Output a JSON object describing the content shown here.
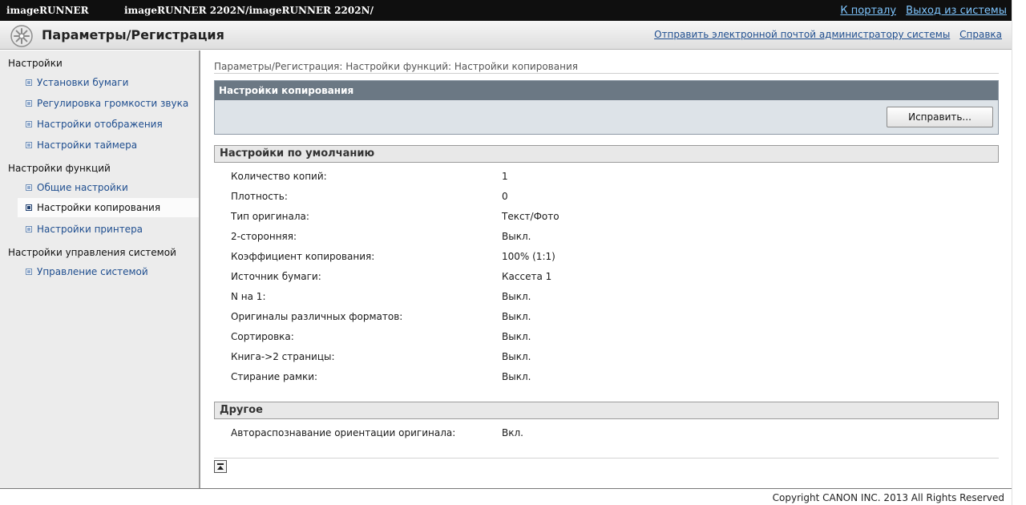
{
  "topbar": {
    "brand": "imageRUNNER",
    "model": "imageRUNNER 2202N/imageRUNNER 2202N/",
    "portal_link": "К порталу",
    "logout_link": "Выход из системы"
  },
  "header": {
    "title": "Параметры/Регистрация",
    "email_admin_link": "Отправить электронной почтой администратору системы",
    "help_link": "Справка"
  },
  "sidebar": {
    "sections": [
      {
        "title": "Настройки",
        "items": [
          {
            "label": "Установки бумаги"
          },
          {
            "label": "Регулировка громкости звука"
          },
          {
            "label": "Настройки отображения"
          },
          {
            "label": "Настройки таймера"
          }
        ]
      },
      {
        "title": "Настройки функций",
        "items": [
          {
            "label": "Общие настройки"
          },
          {
            "label": "Настройки копирования",
            "active": true
          },
          {
            "label": "Настройки принтера"
          }
        ]
      },
      {
        "title": "Настройки управления системой",
        "items": [
          {
            "label": "Управление системой"
          }
        ]
      }
    ]
  },
  "main": {
    "breadcrumb": "Параметры/Регистрация: Настройки функций: Настройки копирования",
    "panel_title": "Настройки копирования",
    "edit_button": "Исправить...",
    "defaults": {
      "title": "Настройки по умолчанию",
      "rows": [
        {
          "key": "Количество копий:",
          "value": "1"
        },
        {
          "key": "Плотность:",
          "value": "0"
        },
        {
          "key": "Тип оригинала:",
          "value": "Текст/Фото"
        },
        {
          "key": "2-сторонняя:",
          "value": "Выкл."
        },
        {
          "key": "Коэффициент копирования:",
          "value": "100% (1:1)"
        },
        {
          "key": "Источник бумаги:",
          "value": "Кассета 1"
        },
        {
          "key": "N на 1:",
          "value": "Выкл."
        },
        {
          "key": "Оригиналы различных форматов:",
          "value": "Выкл."
        },
        {
          "key": "Сортировка:",
          "value": "Выкл."
        },
        {
          "key": "Книга->2 страницы:",
          "value": "Выкл."
        },
        {
          "key": "Стирание рамки:",
          "value": "Выкл."
        }
      ]
    },
    "other": {
      "title": "Другое",
      "rows": [
        {
          "key": "Автораспознавание ориентации оригинала:",
          "value": "Вкл."
        }
      ]
    }
  },
  "footer": {
    "copyright": "Copyright CANON INC. 2013 All Rights Reserved"
  }
}
